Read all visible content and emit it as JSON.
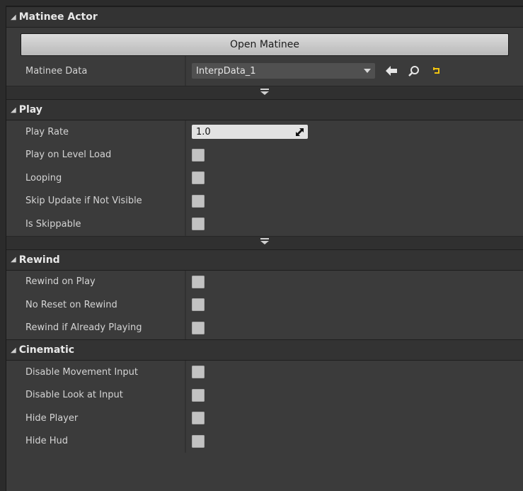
{
  "sections": {
    "matinee_actor": {
      "title": "Matinee Actor",
      "open_button": "Open Matinee",
      "data_label": "Matinee Data",
      "data_value": "InterpData_1",
      "icons": [
        "arrow-left-icon",
        "search-icon",
        "reset-icon"
      ]
    },
    "play": {
      "title": "Play",
      "rate_label": "Play Rate",
      "rate_value": "1.0",
      "items": [
        {
          "label": "Play on Level Load",
          "checked": false
        },
        {
          "label": "Looping",
          "checked": false
        },
        {
          "label": "Skip Update if Not Visible",
          "checked": false
        },
        {
          "label": "Is Skippable",
          "checked": false
        }
      ]
    },
    "rewind": {
      "title": "Rewind",
      "items": [
        {
          "label": "Rewind on Play",
          "checked": false
        },
        {
          "label": "No Reset on Rewind",
          "checked": false
        },
        {
          "label": "Rewind if Already Playing",
          "checked": false
        }
      ]
    },
    "cinematic": {
      "title": "Cinematic",
      "items": [
        {
          "label": "Disable Movement Input",
          "checked": false
        },
        {
          "label": "Disable Look at Input",
          "checked": false
        },
        {
          "label": "Hide Player",
          "checked": false
        },
        {
          "label": "Hide Hud",
          "checked": false
        }
      ]
    }
  },
  "colors": {
    "panel_bg": "#3b3b3b",
    "header_bg": "#333333",
    "checkbox": "#c2c2c2",
    "reset_icon": "#f1c40f"
  }
}
